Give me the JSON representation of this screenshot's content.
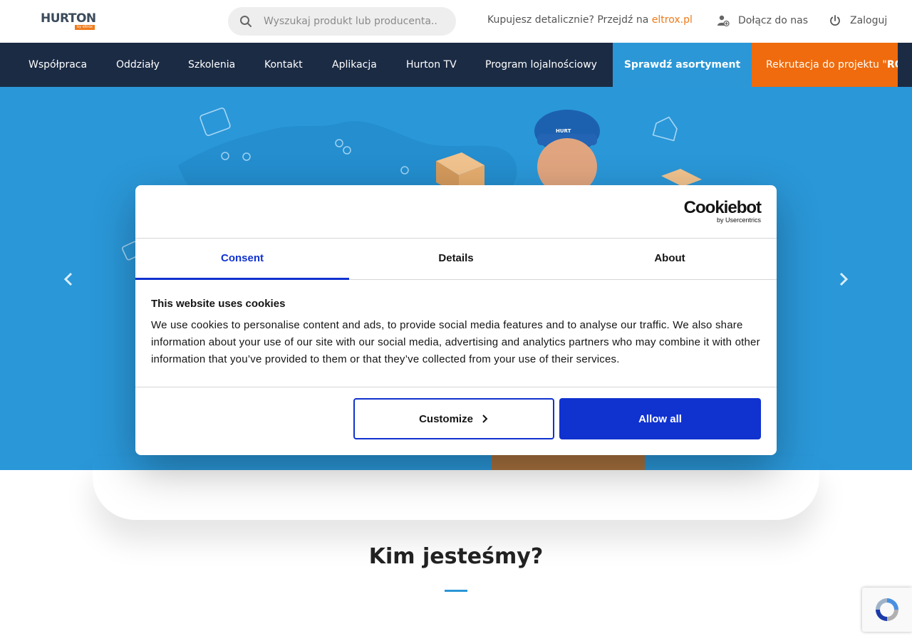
{
  "header": {
    "logo_text": "HURTON",
    "logo_sub": "by eltrox",
    "search_placeholder": "Wyszukaj produkt lub producenta..",
    "retail_prefix": "Kupujesz detalicznie? Przejdź na ",
    "retail_link": "eltrox.pl",
    "join_label": "Dołącz do nas",
    "login_label": "Zaloguj"
  },
  "nav": {
    "items": [
      {
        "label": "Współpraca"
      },
      {
        "label": "Oddziały"
      },
      {
        "label": "Szkolenia"
      },
      {
        "label": "Kontakt"
      },
      {
        "label": "Aplikacja"
      },
      {
        "label": "Hurton TV"
      },
      {
        "label": "Program lojalnościowy"
      }
    ],
    "cta_blue": "Sprawdź asortyment",
    "cta_orange_prefix": "Rekrutacja do projektu \"",
    "cta_orange_bold": "RO"
  },
  "hero": {
    "cap_text": "HURT"
  },
  "cookie_dialog": {
    "brand": "Cookiebot",
    "brand_sub": "by Usercentrics",
    "tabs": [
      {
        "label": "Consent",
        "active": true
      },
      {
        "label": "Details",
        "active": false
      },
      {
        "label": "About",
        "active": false
      }
    ],
    "title": "This website uses cookies",
    "text": "We use cookies to personalise content and ads, to provide social media features and to analyse our traffic. We also share information about your use of our site with our social media, advertising and analytics partners who may combine it with other information that you’ve provided to them or that they’ve collected from your use of their services.",
    "customize_label": "Customize",
    "allow_label": "Allow all"
  },
  "section": {
    "title": "Kim jesteśmy?"
  },
  "colors": {
    "nav_bg": "#1b2b44",
    "accent_orange": "#ef6b0d",
    "accent_blue": "#2b97d6",
    "cookie_blue": "#1032cf"
  }
}
